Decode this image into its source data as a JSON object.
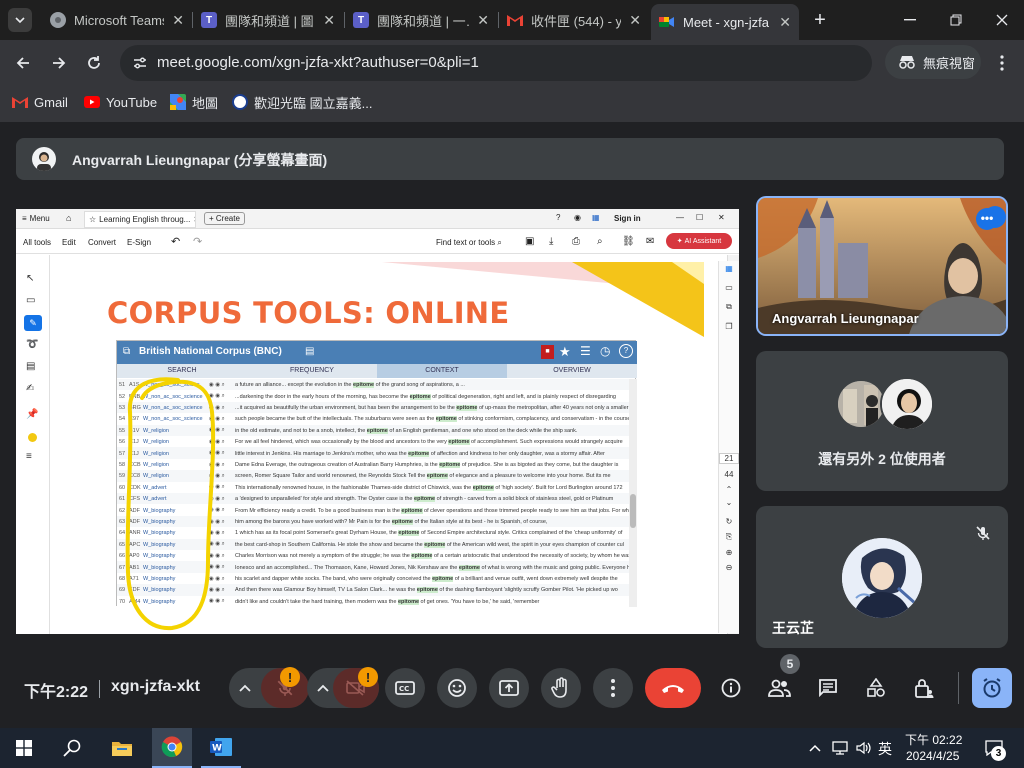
{
  "browser": {
    "tabs": [
      {
        "title": "Microsoft Teams",
        "icon": "teams-icon",
        "active": false
      },
      {
        "title": "團隊和頻道 | 圖…",
        "icon": "teams-icon",
        "active": false
      },
      {
        "title": "團隊和頻道 | 一…",
        "icon": "teams-icon",
        "active": false
      },
      {
        "title": "收件匣 (544) - y",
        "icon": "gmail-icon",
        "active": false
      },
      {
        "title": "Meet - xgn-jzfa",
        "icon": "meet-icon",
        "active": true
      }
    ],
    "url": "meet.google.com/xgn-jzfa-xkt?authuser=0&pli=1",
    "incognito_label": "無痕視窗",
    "bookmarks": [
      {
        "label": "Gmail",
        "icon": "gmail-icon"
      },
      {
        "label": "YouTube",
        "icon": "youtube-icon"
      },
      {
        "label": "地圖",
        "icon": "maps-icon"
      },
      {
        "label": "歡迎光臨 國立嘉義...",
        "icon": "ncyu-icon"
      }
    ]
  },
  "meet": {
    "presenter_label": "Angvarrah Lieungnapar (分享螢幕畫面)",
    "time": "下午2:22",
    "meeting_code": "xgn-jzfa-xkt",
    "participants_count": "5",
    "tiles": [
      {
        "name": "Angvarrah Lieungnapar",
        "type": "video"
      },
      {
        "label": "還有另外 2 位使用者",
        "type": "group"
      },
      {
        "name": "王云芷",
        "type": "avatar",
        "muted": true
      }
    ],
    "colors": {
      "end_call": "#ea4335",
      "accent": "#8ab4f8",
      "warn": "#f29900"
    }
  },
  "shared_screen": {
    "viewer": {
      "menu": "Menu",
      "tab_title": "Learning English throug...",
      "create": "Create",
      "sign_in": "Sign in",
      "menus": [
        "All tools",
        "Edit",
        "Convert",
        "E-Sign"
      ],
      "find": "Find text or tools",
      "ai": "AI Assistant",
      "page_num": "21",
      "page_total": "44"
    },
    "slide": {
      "title": "CORPUS TOOLS: ONLINE",
      "bnc_title": "British National Corpus (BNC)",
      "bnc_tabs": [
        "SEARCH",
        "FREQUENCY",
        "CONTEXT",
        "OVERVIEW"
      ],
      "rows": [
        {
          "n": "51",
          "code": "A1S",
          "genre": "W_non_ac_soc_scienc",
          "text": "a future an alliance... except the evolution in the epitome of the grand song of aspirations, a ..."
        },
        {
          "n": "52",
          "code": "BNB",
          "genre": "W_non_ac_soc_science",
          "text": "...darkening the door in the early hours of the morning, has become the epitome of political degeneration, right and left, and is plainly respect of disregarding"
        },
        {
          "n": "53",
          "code": "BRG",
          "genre": "W_non_ac_soc_science",
          "text": "...it acquired as beautifully the urban environment, but has been the arrangement to be the epitome of up-mass the metropolitan, after 40 years not only a smaller"
        },
        {
          "n": "54",
          "code": "C97",
          "genre": "W_non_ac_soc_science",
          "text": "such people became the butt of the intellectuals. The suburbans were seen as the epitome of stinking conformism, complacency, and conservatism - in the course"
        },
        {
          "n": "55",
          "code": "B1V",
          "genre": "W_religion",
          "text": "in the old estimate, and not to be a snob, intellect, the epitome of an English gentleman, and one who stood on the deck while the ship sank."
        },
        {
          "n": "56",
          "code": "C1J",
          "genre": "W_religion",
          "text": "For we all feel hindered, which was occasionally by the blood and ancestors to the very epitome of accomplishment. Such expressions would strangely acquire"
        },
        {
          "n": "57",
          "code": "C1J",
          "genre": "W_religion",
          "text": "little interest in Jenkins. His marriage to Jenkins's mother, who was the epitome of affection and kindness to her only daughter, was a stormy affair. After"
        },
        {
          "n": "58",
          "code": "CCB",
          "genre": "W_religion",
          "text": "Dame Edna Everage, the outrageous creation of Australian Barry Humphries, is the epitome of prejudice. She is as bigoted as they come, but the daughter is"
        },
        {
          "n": "59",
          "code": "CC8",
          "genre": "W_religion",
          "text": "screen, Romer Square Tailor and world renowned, the Reynolds Stock Tell the epitome of elegance and a pleasure to welcome into your home. But its me"
        },
        {
          "n": "60",
          "code": "CDK",
          "genre": "W_advert",
          "text": "This internationally renowned house, in the fashionable Thames-side district of Chiswick, was the epitome of 'high society'. Built for Lord Burlington around 172"
        },
        {
          "n": "61",
          "code": "CFS",
          "genre": "W_advert",
          "text": "a 'designed to unparalleled' for style and strength. The Oyster case is the epitome of strength - carved from a solid block of stainless steel, gold or Platinum"
        },
        {
          "n": "62",
          "code": "ADF",
          "genre": "W_biography",
          "text": "From Mr efficiency ready a credit. To be a good business man is the epitome of clever operations and those trimmed people ready to see him as that jobs. For what as"
        },
        {
          "n": "63",
          "code": "ADF",
          "genre": "W_biography",
          "text": "him among the barons you have worked with? Mr Pain is for the epitome of the Italian style at its best - he is Spanish, of course,"
        },
        {
          "n": "64",
          "code": "ANR",
          "genre": "W_biography",
          "text": "1 which has as its focal point Somerset's great Dyrham House, the epitome of Second Empire architectural style. Critics complained of the 'cheap uniformity' of"
        },
        {
          "n": "65",
          "code": "APC",
          "genre": "W_biography",
          "text": "the best card-shop in Southern California. He stole the show and became the epitome of the American wild west, the spirit in your eyes champion of counter cul"
        },
        {
          "n": "66",
          "code": "AP0",
          "genre": "W_biography",
          "text": "Charles Morrison was not merely a symptom of the struggle; he was the epitome of a certain aristocratic that understood the necessity of society, by whom he was"
        },
        {
          "n": "67",
          "code": "AB1",
          "genre": "W_biography",
          "text": "Ionesco and an accomplished... The Thomason, Kane, Howard Jones, Nik Kershaw are the epitome of what is wrong with the music and going public. Everyone has"
        },
        {
          "n": "68",
          "code": "A71",
          "genre": "W_biography",
          "text": "his scarlet and dapper white socks. The band, who were originally conceived the epitome of a brilliant and venue outfit, went down extremely well despite the"
        },
        {
          "n": "69",
          "code": "EDF",
          "genre": "W_biography",
          "text": "And then there was Glamour Boy himself, TV La Salon Clark... he was the epitome of the dashing flamboyant 'slightly scruffy Gomber Pilot. 'He picked up wo"
        },
        {
          "n": "70",
          "code": "AM4",
          "genre": "W_biography",
          "text": "didn't like and couldn't take the hard training, then modern was the epitome of get ones. 'You have to be,' he said, 'remember"
        }
      ]
    }
  },
  "taskbar": {
    "time": "下午 02:22",
    "date": "2024/4/25",
    "ime": "英",
    "notifications": "3"
  }
}
